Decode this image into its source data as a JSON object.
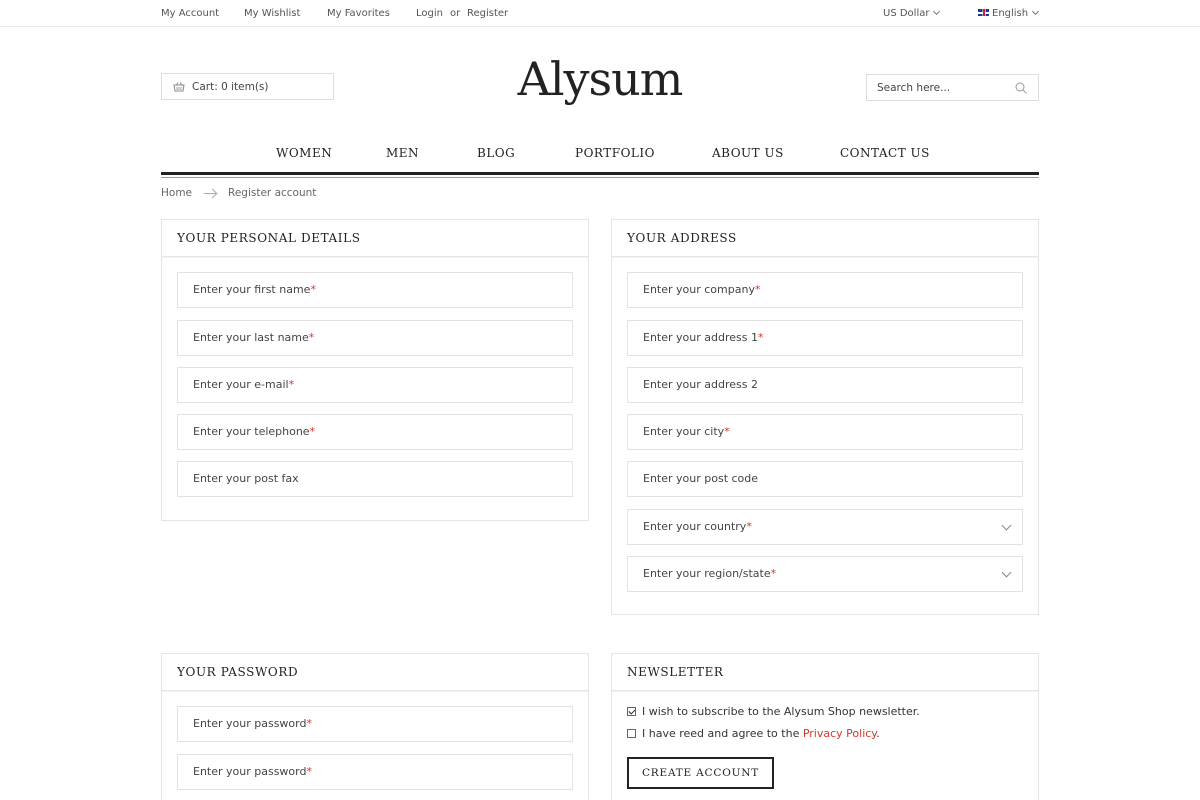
{
  "topbar": {
    "my_account": "My Account",
    "my_wishlist": "My Wishlist",
    "my_favorites": "My Favorites",
    "login": "Login",
    "or": "or",
    "register": "Register",
    "currency": "US Dollar",
    "language": "English"
  },
  "header": {
    "cart_label": "Cart: 0 item(s)",
    "logo": "Alysum",
    "search_placeholder": "Search here..."
  },
  "nav": {
    "items": [
      "WOMEN",
      "MEN",
      "BLOG",
      "PORTFOLIO",
      "ABOUT US",
      "CONTACT US"
    ]
  },
  "breadcrumb": {
    "home": "Home",
    "current": "Register account"
  },
  "personal": {
    "title": "YOUR PERSONAL DETAILS",
    "fields": [
      {
        "label": "Enter your first name",
        "required": "*"
      },
      {
        "label": "Enter your last name",
        "required": "*"
      },
      {
        "label": "Enter your e-mail",
        "required": "*"
      },
      {
        "label": "Enter your telephone",
        "required": "*"
      },
      {
        "label": "Enter your post fax",
        "required": ""
      }
    ]
  },
  "address": {
    "title": "YOUR ADDRESS",
    "fields": [
      {
        "label": "Enter your company",
        "required": "*"
      },
      {
        "label": "Enter your address 1",
        "required": "*"
      },
      {
        "label": "Enter your address 2",
        "required": ""
      },
      {
        "label": "Enter your city",
        "required": "*"
      },
      {
        "label": "Enter your post code",
        "required": ""
      },
      {
        "label": "Enter your country",
        "required": "*"
      },
      {
        "label": "Enter your region/state",
        "required": "*"
      }
    ]
  },
  "password": {
    "title": "YOUR PASSWORD",
    "fields": [
      {
        "label": "Enter your password",
        "required": "*"
      },
      {
        "label": "Enter your password",
        "required": "*"
      }
    ]
  },
  "newsletter": {
    "title": "NEWSLETTER",
    "subscribe_text": "I wish to subscribe to the Alysum Shop newsletter.",
    "subscribe_checked": true,
    "agree_text": "I have reed and agree to the",
    "privacy_link": "Privacy Policy",
    "agree_end": ".",
    "agree_checked": false,
    "create_button": "CREATE ACCOUNT"
  },
  "colors": {
    "accent_red": "#d9342b",
    "text_dark": "#222222",
    "border": "#e5e5e5"
  }
}
